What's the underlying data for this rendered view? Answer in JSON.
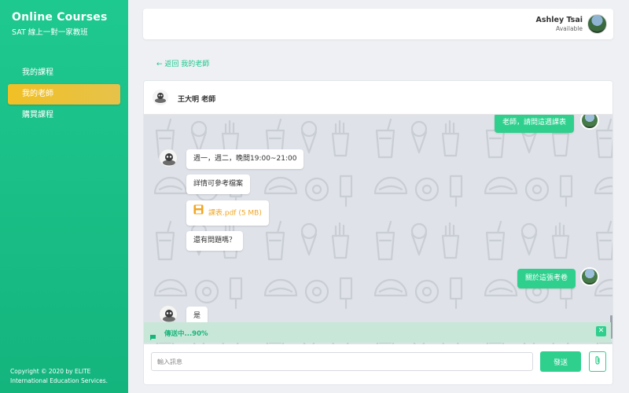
{
  "sidebar": {
    "brand_title": "Online Courses",
    "brand_subtitle": "SAT 線上一對一家教班",
    "nav": [
      {
        "label": "我的課程",
        "active": false
      },
      {
        "label": "我的老師",
        "active": true
      },
      {
        "label": "購買課程",
        "active": false
      }
    ],
    "copyright": "Copyright © 2020 by ELITE International Education Services."
  },
  "header": {
    "user_name": "Ashley Tsai",
    "user_status": "Available",
    "avatar_icon": "user-avatar-icon"
  },
  "back_link": "← 返回 我的老師",
  "chat": {
    "teacher_name": "王大明 老師",
    "messages": {
      "out_1": "老師，請問這週課表",
      "in_1": "週一，週二，晚間19:00~21:00",
      "in_2": "詳情可參考檔案",
      "in_3_file": "課表.pdf (5 MB)",
      "in_4": "還有問題嗎？",
      "out_2": "關於這張考卷",
      "in_5": "是"
    },
    "upload_status": "傳送中...90%",
    "input_placeholder": "輸入訊息",
    "input_value": "",
    "send_label": "發送"
  },
  "colors": {
    "accent": "#2fd08e",
    "sidebar": "#1ec98f",
    "active_nav": "#f1c026",
    "file": "#f0a623"
  }
}
